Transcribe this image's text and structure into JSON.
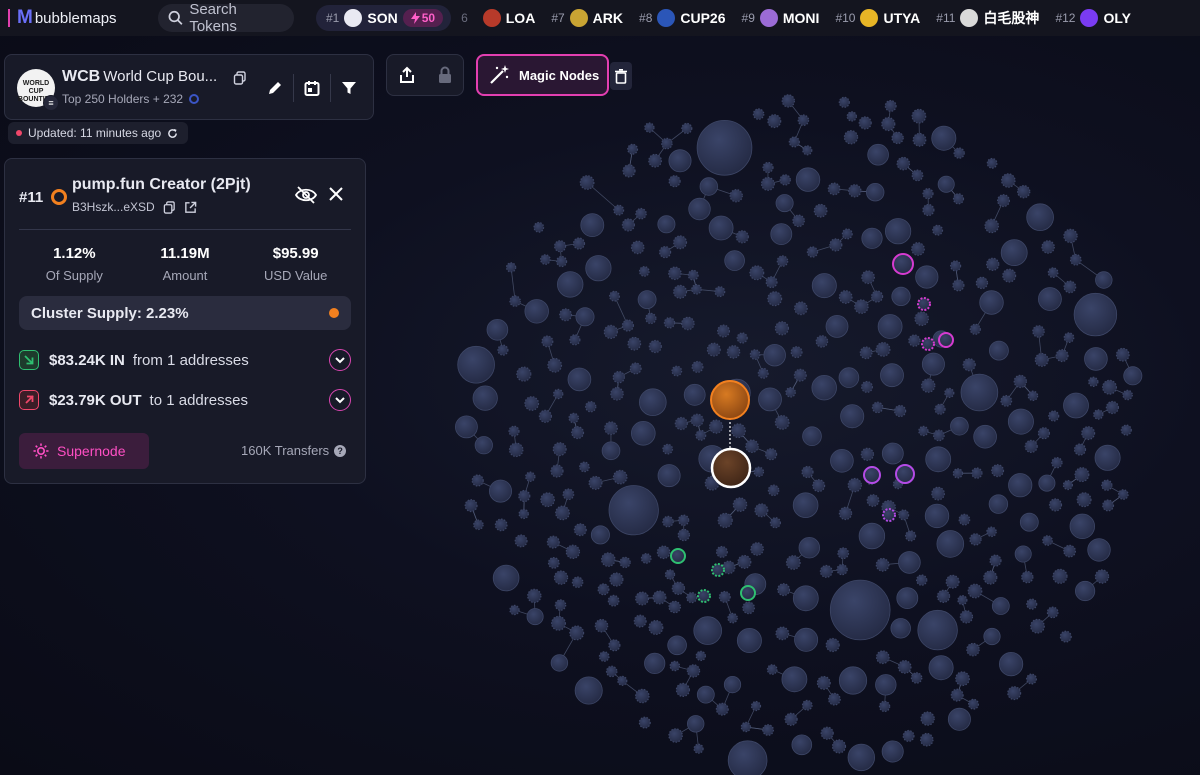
{
  "app": {
    "name": "bubblemaps"
  },
  "search": {
    "label": "Search Tokens"
  },
  "trending": [
    {
      "rank": "#1",
      "symbol": "SON",
      "boost": "50",
      "icon": "son-token-icon",
      "color": "#e9e9f2"
    },
    {
      "rank": "#7",
      "symbol": "ARK",
      "icon": "ark-token-icon",
      "color": "#c9a433"
    },
    {
      "rank": "#8",
      "symbol": "CUP26",
      "icon": "cup26-token-icon",
      "color": "#2b56b8"
    },
    {
      "rank": "#9",
      "symbol": "MONI",
      "icon": "moni-token-icon",
      "color": "#9b6bd6"
    },
    {
      "rank": "#10",
      "symbol": "UTYA",
      "icon": "utya-token-icon",
      "color": "#e7b526"
    },
    {
      "rank": "#11",
      "symbol": "白毛股神",
      "icon": "baimao-token-icon",
      "color": "#d9d9d9"
    },
    {
      "rank": "#12",
      "symbol": "OLY",
      "icon": "oly-token-icon",
      "color": "#7a3bf2"
    }
  ],
  "trending_partial": {
    "rank": "6",
    "symbol": "LOA",
    "color": "#b73a2a"
  },
  "token": {
    "symbol": "WCB",
    "name": "World Cup Bou...",
    "logo_text": "WORLD CUP BOUNTIES",
    "holders": "Top 250 Holders + 232",
    "updated": "Updated: 11 minutes ago"
  },
  "actions": {
    "magic_nodes": "Magic Nodes"
  },
  "holder": {
    "rank": "#11",
    "name": "pump.fun Creator (2Pjt)",
    "address": "B3Hszk...eXSD",
    "supply": "1.12%",
    "supply_label": "Of Supply",
    "amount": "11.19M",
    "amount_label": "Amount",
    "usd": "$95.99",
    "usd_label": "USD Value",
    "cluster": "Cluster Supply: 2.23%",
    "in_amount": "$83.24K IN",
    "in_text": "from 1 addresses",
    "out_amount": "$23.79K OUT",
    "out_text": "to 1 addresses",
    "supernode": "Supernode",
    "transfers": "160K Transfers"
  },
  "colors": {
    "accent": "#e33fb1",
    "bubble": "#242a44",
    "selected": "#f2801f",
    "in": "#2fbf71",
    "out": "#f0476a",
    "magenta_cluster": "#d63bd0",
    "purple_cluster": "#b44be6",
    "green_cluster": "#2fbf71"
  }
}
